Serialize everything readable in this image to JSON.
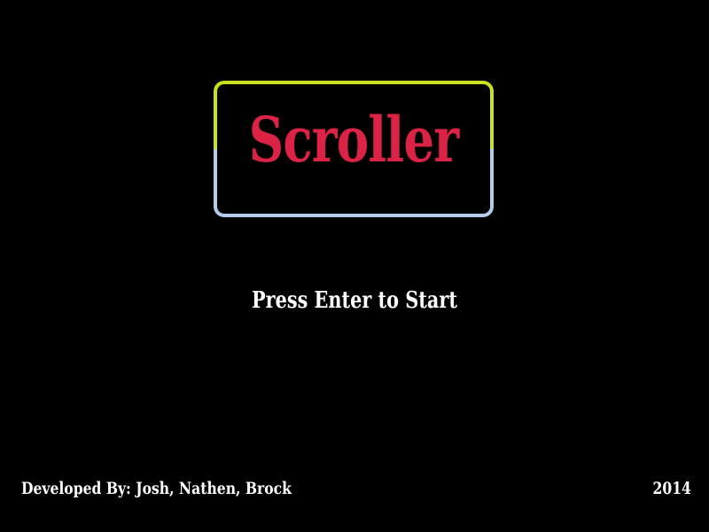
{
  "game": {
    "title": "Scroller",
    "prompt": "Press Enter to Start",
    "credits": "Developed By: Josh, Nathen, Brock",
    "year": "2014"
  },
  "colors": {
    "background": "#000000",
    "title_text": "#dc2346",
    "frame_top": "#c8e01e",
    "frame_bottom": "#b4ccec",
    "text": "#ffffff"
  }
}
